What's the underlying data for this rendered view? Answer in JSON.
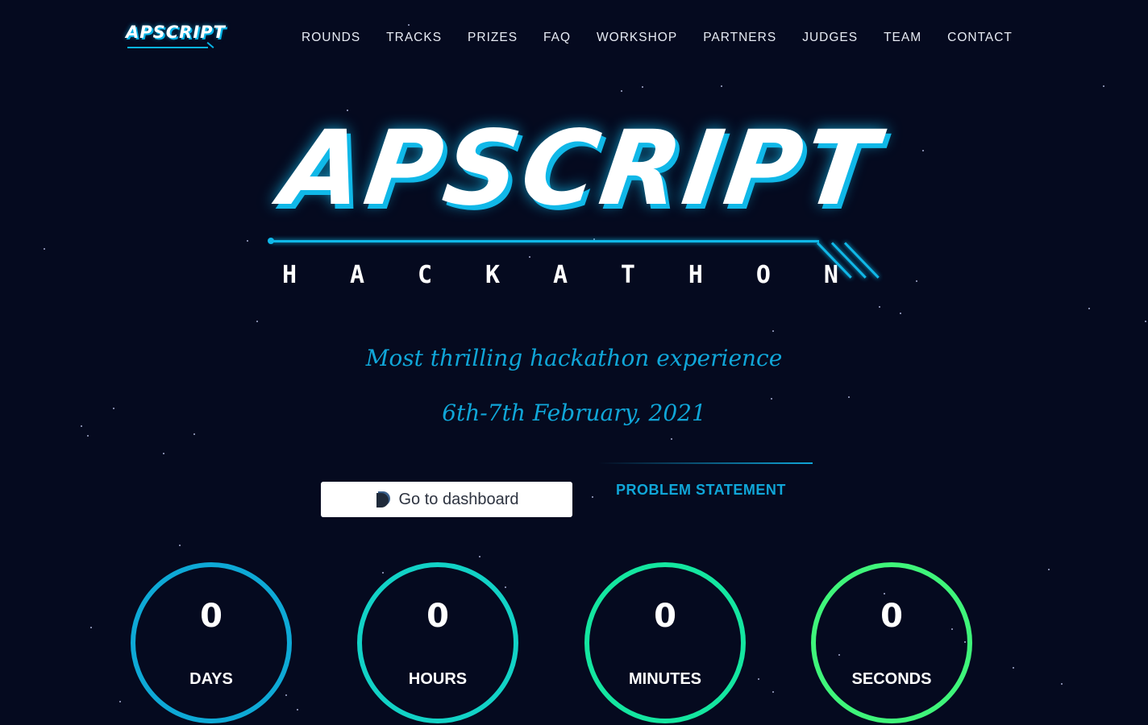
{
  "header": {
    "logo_text": "APSCRIPT",
    "nav": [
      {
        "label": "ROUNDS"
      },
      {
        "label": "TRACKS"
      },
      {
        "label": "PRIZES"
      },
      {
        "label": "FAQ"
      },
      {
        "label": "WORKSHOP"
      },
      {
        "label": "PARTNERS"
      },
      {
        "label": "JUDGES"
      },
      {
        "label": "TEAM"
      },
      {
        "label": "CONTACT"
      }
    ]
  },
  "hero": {
    "title": "APSCRIPT",
    "subtitle_letters": [
      "H",
      "A",
      "C",
      "K",
      "A",
      "T",
      "H",
      "O",
      "N"
    ],
    "tagline": "Most thrilling hackathon experience",
    "date": "6th-7th February, 2021"
  },
  "actions": {
    "dashboard_label": "Go to dashboard",
    "problem_statement_label": "PROBLEM STATEMENT"
  },
  "countdown": [
    {
      "value": "0",
      "unit": "DAYS",
      "color": "#0ea9d6"
    },
    {
      "value": "0",
      "unit": "HOURS",
      "color": "#12d2c6"
    },
    {
      "value": "0",
      "unit": "MINUTES",
      "color": "#14e6a0"
    },
    {
      "value": "0",
      "unit": "SECONDS",
      "color": "#3ff57a"
    }
  ],
  "colors": {
    "background": "#050a1f",
    "accent": "#10a6d8"
  }
}
